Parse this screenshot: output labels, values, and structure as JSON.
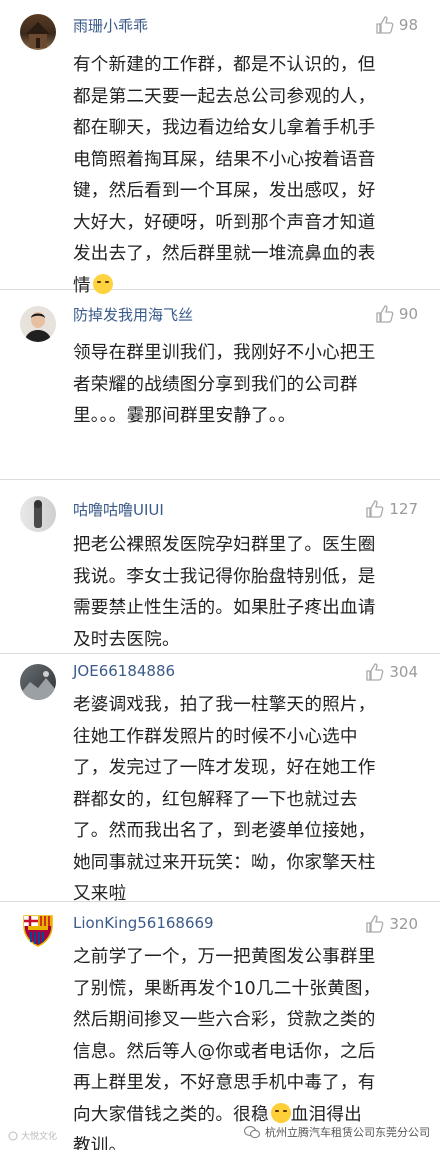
{
  "comments": [
    {
      "username": "雨珊小乖乖",
      "likes": "98",
      "lines": [
        "有个新建的工作群，都是不认识的，但",
        "都是第二天要一起去总公司参观的人，",
        "都在聊天，我边看边给女儿拿着手机手",
        "电筒照着掏耳屎，结果不小心按着语音",
        "键，然后看到一个耳屎，发出感叹，好",
        "大好大，好硬呀，听到那个声音才知道",
        "发出去了，然后群里就一堆流鼻血的表",
        "情"
      ]
    },
    {
      "username": "防掉发我用海飞丝",
      "likes": "90",
      "lines": [
        "领导在群里训我们，我刚好不小心把王",
        "者荣耀的战绩图分享到我们的公司群",
        "里。。。霎那间群里安静了。。"
      ]
    },
    {
      "username": "咕噜咕噜UIUI",
      "likes": "127",
      "lines": [
        "把老公裸照发医院孕妇群里了。医生圈",
        "我说。李女士我记得你胎盘特别低，是",
        "需要禁止性生活的。如果肚子疼出血请",
        "及时去医院。"
      ]
    },
    {
      "username": "JOE66184886",
      "likes": "304",
      "lines": [
        "老婆调戏我，拍了我一柱擎天的照片，",
        "往她工作群发照片的时候不小心选中",
        "了，发完过了一阵才发现，好在她工作",
        "群都女的，红包解释了一下也就过去",
        "了。然而我出名了，到老婆单位接她，",
        "她同事就过来开玩笑：呦，你家擎天柱",
        "又来啦"
      ]
    },
    {
      "username": "LionKing56168669",
      "likes": "320",
      "lines": [
        "之前学了一个，万一把黄图发公事群里",
        "了别慌，果断再发个10几二十张黄图，",
        "然后期间掺叉一些六合彩，贷款之类的",
        "信息。然后等人@你或者电话你，之后",
        "再上群里发，不好意思手机中毒了，有",
        "向大家借钱之类的。很稳",
        "教训。"
      ],
      "line6_tail": "血泪得出"
    }
  ],
  "watermark_left": "大悦文化",
  "watermark_right": "杭州立腾汽车租赁公司东莞分公司"
}
